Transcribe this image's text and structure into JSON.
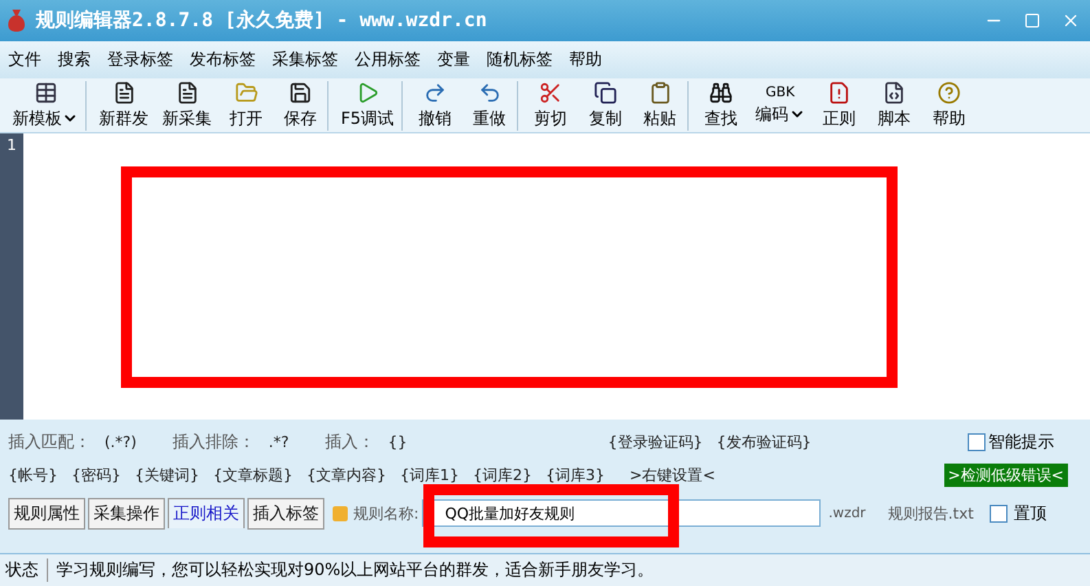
{
  "window": {
    "title": "规则编辑器2.8.7.8 [永久免费] - www.wzdr.cn"
  },
  "menu": [
    "文件",
    "搜索",
    "登录标签",
    "发布标签",
    "采集标签",
    "公用标签",
    "变量",
    "随机标签",
    "帮助"
  ],
  "toolbar": [
    {
      "label": "新模板",
      "dropdown": true,
      "separator_after": true
    },
    {
      "label": "新群发",
      "dropdown": false,
      "separator_after": false
    },
    {
      "label": "新采集",
      "dropdown": false,
      "separator_after": false
    },
    {
      "label": "打开",
      "dropdown": false,
      "separator_after": false
    },
    {
      "label": "保存",
      "dropdown": false,
      "separator_after": true
    },
    {
      "label": "F5调试",
      "dropdown": false,
      "separator_after": true
    },
    {
      "label": "撤销",
      "dropdown": false,
      "separator_after": false
    },
    {
      "label": "重做",
      "dropdown": false,
      "separator_after": true
    },
    {
      "label": "剪切",
      "dropdown": false,
      "separator_after": false
    },
    {
      "label": "复制",
      "dropdown": false,
      "separator_after": false
    },
    {
      "label": "粘贴",
      "dropdown": false,
      "separator_after": true
    },
    {
      "label": "查找",
      "dropdown": false,
      "separator_after": false
    },
    {
      "label": "编码",
      "icon_text": "GBK",
      "dropdown": true,
      "separator_after": false
    },
    {
      "label": "正则",
      "dropdown": false,
      "separator_after": false
    },
    {
      "label": "脚本",
      "dropdown": false,
      "separator_after": false
    },
    {
      "label": "帮助",
      "dropdown": false,
      "separator_after": false
    }
  ],
  "editor": {
    "line_numbers": [
      "1"
    ]
  },
  "annotations": [
    {
      "kind": "highlight"
    },
    {
      "kind": "highlight"
    }
  ],
  "insert_row": [
    {
      "label": "插入匹配：",
      "value": "(.*?)"
    },
    {
      "label": "插入排除：",
      "value": ".*?"
    },
    {
      "label": "插入：",
      "value": "{}"
    }
  ],
  "verify_tags": [
    "{登录验证码}",
    "{发布验证码}"
  ],
  "smart_hint": {
    "label": "智能提示",
    "checked": false
  },
  "tags": [
    "{帐号}",
    "{密码}",
    "{关键词}",
    "{文章标题}",
    "{文章内容}",
    "{词库1}",
    "{词库2}",
    "{词库3}"
  ],
  "right_click": ">右键设置<",
  "check_button": ">检测低级错误<",
  "tabs": [
    {
      "label": "规则属性",
      "selected": false
    },
    {
      "label": "采集操作",
      "selected": false
    },
    {
      "label": "正则相关",
      "selected": true
    },
    {
      "label": "插入标签",
      "selected": false
    }
  ],
  "rule_name": {
    "label": "规则名称:",
    "value": "QQ批量加好友规则"
  },
  "extension": ".wzdr",
  "report": "规则报告.txt",
  "pin": {
    "label": "置顶",
    "checked": false
  },
  "status_bar": {
    "label": "状态",
    "message": "学习规则编写，您可以轻松实现对90%以上网站平台的群发，适合新手朋友学习。"
  }
}
